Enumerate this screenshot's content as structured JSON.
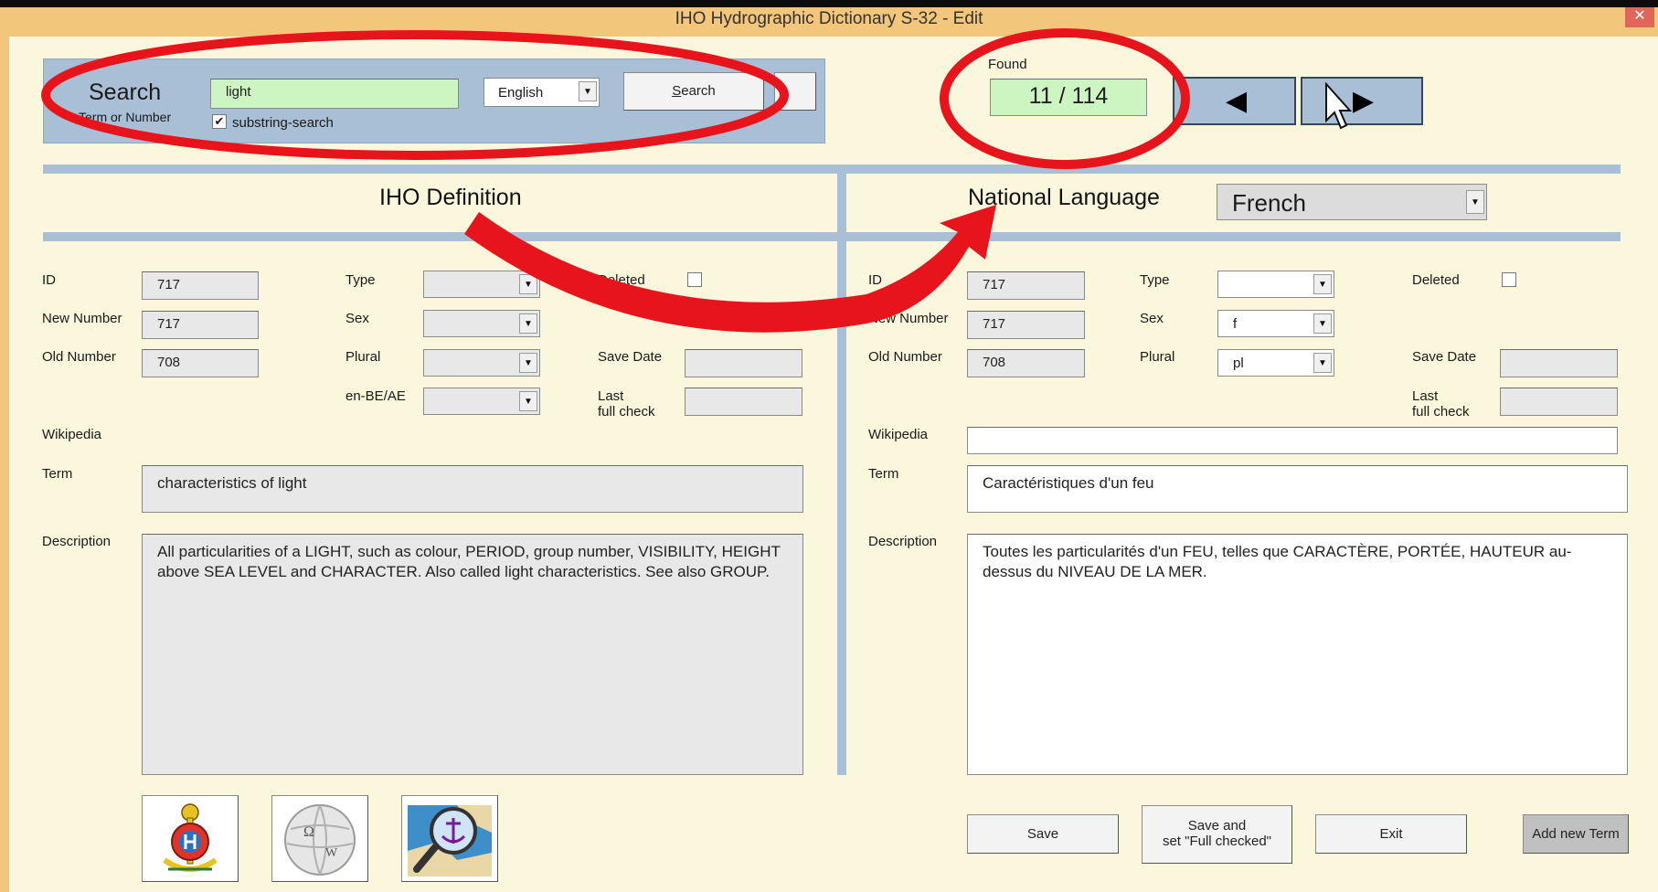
{
  "window": {
    "title": "IHO Hydrographic Dictionary S-32 - Edit",
    "close_glyph": "✕"
  },
  "search": {
    "label": "Search",
    "sublabel": "Term or Number",
    "value": "light",
    "language": "English",
    "substring_label": "substring-search",
    "substring_checked": "✔",
    "button_label": "Search",
    "button_accel": "S",
    "button_rest": "earch"
  },
  "found": {
    "label": "Found",
    "value": "11 / 114"
  },
  "nav": {
    "prev_glyph": "◀",
    "next_glyph": "▶"
  },
  "iho": {
    "heading": "IHO Definition",
    "id_label": "ID",
    "id": "717",
    "new_number_label": "New Number",
    "new_number": "717",
    "old_number_label": "Old Number",
    "old_number": "708",
    "type_label": "Type",
    "sex_label": "Sex",
    "plural_label": "Plural",
    "enbe_label": "en-BE/AE",
    "deleted_label": "Deleted",
    "save_date_label": "Save Date",
    "last_check_label_1": "Last",
    "last_check_label_2": "full check",
    "wikipedia_label": "Wikipedia",
    "term_label": "Term",
    "term": "characteristics of light",
    "description_label": "Description",
    "description": "All particularities of a LIGHT, such as colour, PERIOD, group number, VISIBILITY, HEIGHT above SEA LEVEL and CHARACTER. Also called light characteristics. See also GROUP."
  },
  "national": {
    "heading": "National Language",
    "language": "French",
    "id_label": "ID",
    "id": "717",
    "new_number_label": "New Number",
    "new_number": "717",
    "old_number_label": "Old Number",
    "old_number": "708",
    "type_label": "Type",
    "sex_label": "Sex",
    "sex": "f",
    "plural_label": "Plural",
    "plural": "pl",
    "deleted_label": "Deleted",
    "save_date_label": "Save Date",
    "last_check_label_1": "Last",
    "last_check_label_2": "full check",
    "wikipedia_label": "Wikipedia",
    "term_label": "Term",
    "term": "Caractéristiques d'un feu",
    "description_label": "Description",
    "description": "Toutes les particularités d'un FEU, telles que CARACTÈRE, PORTÉE, HAUTEUR au-dessus du NIVEAU DE LA MER."
  },
  "buttons": {
    "save": "Save",
    "save_full_1": "Save and",
    "save_full_2": "set \"Full checked\"",
    "exit": "Exit",
    "add_term": "Add new Term"
  },
  "icons": [
    "iho-logo-icon",
    "wikipedia-icon",
    "chart-search-icon"
  ],
  "annotation_color": "#e8141c"
}
